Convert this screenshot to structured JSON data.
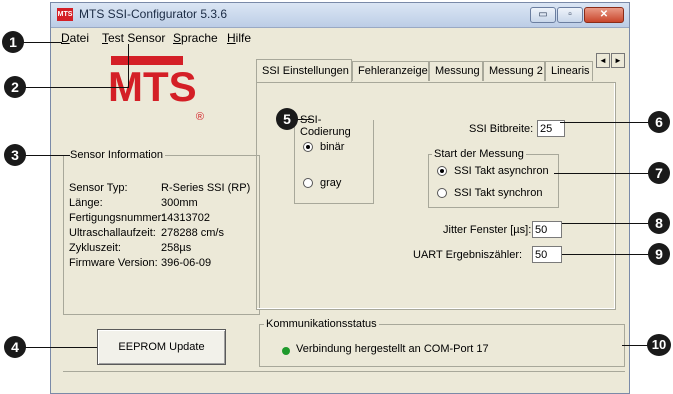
{
  "window": {
    "title": "MTS SSI-Configurator 5.3.6",
    "app_icon_text": "MTS",
    "min_glyph": "▭",
    "max_glyph": "▫",
    "close_glyph": "✕"
  },
  "menu": [
    "Datei",
    "Test Sensor",
    "Sprache",
    "Hilfe"
  ],
  "menu_underline": [
    "D",
    "T",
    "S",
    "H"
  ],
  "logo": {
    "text": "MTS",
    "mark": "®",
    "color": "#d41f26"
  },
  "sensor_info": {
    "legend": "Sensor Information",
    "rows": [
      {
        "label": "Sensor Typ:",
        "value": "R-Series SSI (RP)"
      },
      {
        "label": "Länge:",
        "value": "300mm"
      },
      {
        "label": "Fertigungsnummer:",
        "value": "14313702"
      },
      {
        "label": "Ultraschallaufzeit:",
        "value": "278288 cm/s"
      },
      {
        "label": "Zykluszeit:",
        "value": "258µs"
      },
      {
        "label": "Firmware Version:",
        "value": "396-06-09"
      }
    ]
  },
  "eeprom_button": "EEPROM Update",
  "tabs": [
    "SSI Einstellungen",
    "Fehleranzeige",
    "Messung",
    "Messung 2",
    "Linearis"
  ],
  "tab_scroll": {
    "left": "◄",
    "right": "►"
  },
  "ssi": {
    "codierung_legend": "SSI-Codierung",
    "codierung_options": [
      "binär",
      "gray"
    ],
    "codierung_selected": "binär",
    "bitbreite_label": "SSI Bitbreite:",
    "bitbreite_value": "25",
    "start_legend": "Start der Messung",
    "start_options": [
      "SSI Takt asynchron",
      "SSI Takt synchron"
    ],
    "start_selected": "SSI Takt asynchron",
    "jitter_label": "Jitter Fenster [µs]:",
    "jitter_value": "50",
    "uart_label": "UART Ergebniszähler:",
    "uart_value": "50"
  },
  "status": {
    "legend": "Kommunikationsstatus",
    "text": "Verbindung hergestellt an COM-Port 17",
    "dot_color": "#1f9a2c"
  },
  "callouts": [
    "1",
    "2",
    "3",
    "4",
    "5",
    "6",
    "7",
    "8",
    "9",
    "10"
  ]
}
